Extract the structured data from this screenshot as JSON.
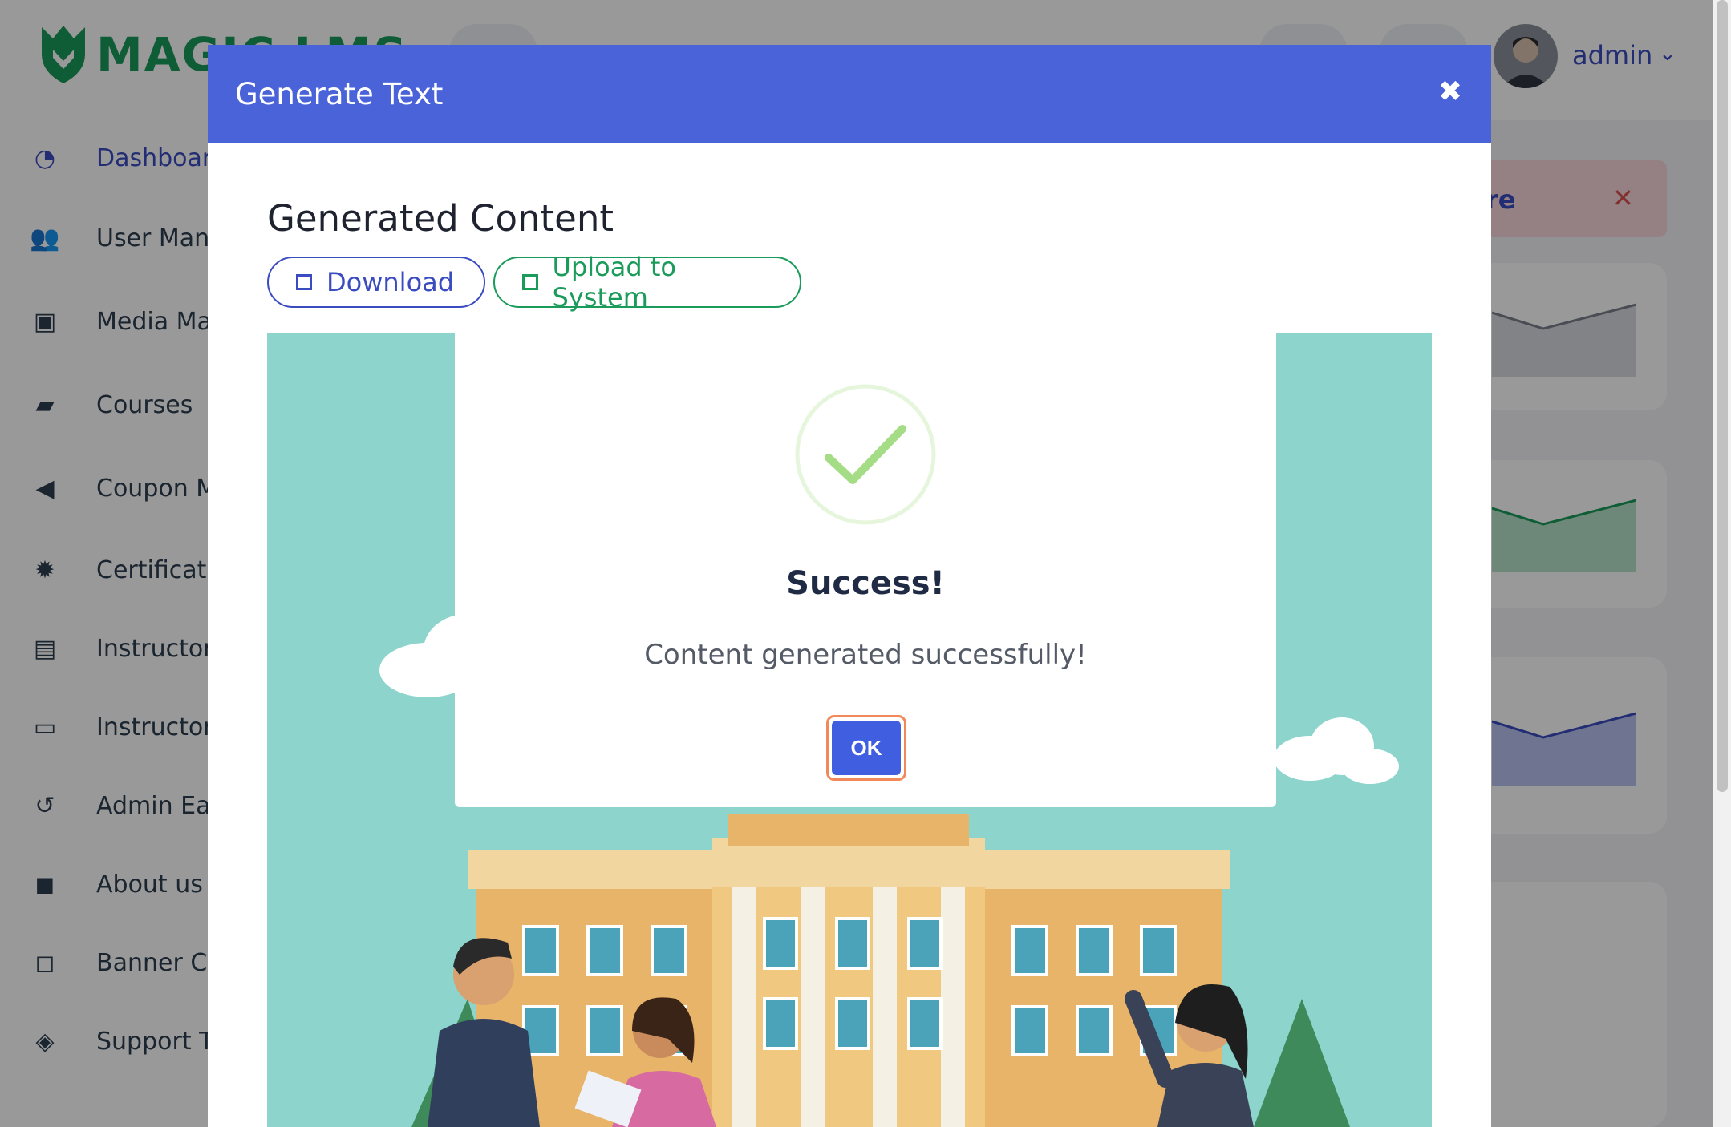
{
  "app": {
    "logo_text": "MAGIC LMS",
    "user_name": "admin"
  },
  "sidebar": {
    "items": [
      {
        "label": "Dashboard",
        "icon": "dashboard-icon",
        "active": true
      },
      {
        "label": "User Management",
        "icon": "users-icon"
      },
      {
        "label": "Media Management",
        "icon": "image-icon"
      },
      {
        "label": "Courses",
        "icon": "book-icon"
      },
      {
        "label": "Coupon Management",
        "icon": "megaphone-icon"
      },
      {
        "label": "Certificates",
        "icon": "badge-icon"
      },
      {
        "label": "Instructors",
        "icon": "briefcase-icon"
      },
      {
        "label": "Instructor Payouts",
        "icon": "money-icon"
      },
      {
        "label": "Admin Earnings",
        "icon": "history-icon"
      },
      {
        "label": "About us Content",
        "icon": "note-icon"
      },
      {
        "label": "Banner Content",
        "icon": "sticky-note-icon"
      },
      {
        "label": "Support Tickets",
        "icon": "ticket-icon"
      }
    ]
  },
  "background": {
    "alert_text": "re"
  },
  "generate_modal": {
    "title": "Generate Text",
    "subtitle": "Generated Content",
    "download_label": "Download",
    "upload_label": "Upload to System"
  },
  "success_dialog": {
    "title": "Success!",
    "message": "Content generated successfully!",
    "ok_label": "OK"
  },
  "colors": {
    "primary": "#3a4cc0",
    "header": "#4a63d8",
    "success_green": "#1a9b5a",
    "check_green": "#a5dc86",
    "ok_button": "#3f5ee0",
    "focus_ring": "#f2895a"
  }
}
